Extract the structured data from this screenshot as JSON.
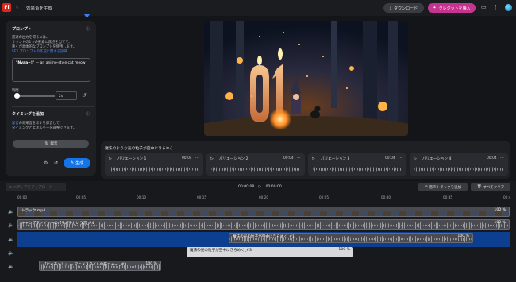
{
  "topbar": {
    "logo": "Fl",
    "title": "効果音を生成",
    "download_label": "ダウンロード",
    "buy_credits_label": "クレジットを購入"
  },
  "prompt_panel": {
    "title": "プロンプト",
    "description_line1": "最適の出力を得るには、",
    "description_line2": "サウンドの1つの要素に焦点を当てて、",
    "description_line3": "速くが具体的なプロンプトを使用します。",
    "link_text": "SFX プロンプトの作成に関する詳細",
    "prompt_quote": "\"Nyaa~!\"",
    "prompt_rest": " — an anime-style cat meow",
    "duration_label": "時間",
    "duration_value": "2s"
  },
  "timing_panel": {
    "title": "タイミングを追加",
    "description_link": "録音",
    "description_rest1": "の効果音を示すを録音して、",
    "description_line2": "タイミングとエネルギーを調整できます。",
    "record_label": "録音",
    "generate_label": "生成"
  },
  "variations": {
    "caption": "魔法のような光の粒子が空中にきらめく",
    "items": [
      {
        "name": "バリエーション 1",
        "duration": "00:04"
      },
      {
        "name": "バリエーション 2",
        "duration": "00:04"
      },
      {
        "name": "バリエーション 3",
        "duration": "00:04"
      },
      {
        "name": "バリエーション 4",
        "duration": "00:04"
      }
    ]
  },
  "timeline": {
    "upload_label": "メディアをアップロード",
    "current_time": "00:00:08",
    "total_time": "00:00:00",
    "add_track_label": "音声トラックを追加",
    "clear_all_label": "すべてクリア",
    "ruler_ticks": [
      "00:00",
      "00:05",
      "00:10",
      "00:15",
      "00:20",
      "00:25",
      "00:30",
      "00:35",
      "00:4"
    ],
    "clips": [
      {
        "label": "トラック.mp4",
        "percent": "100 %"
      },
      {
        "label": "キャンプファイヤーのパチパチという音_#4",
        "percent": "100 %"
      },
      {
        "label": "魔法の光の粒子が空中にきらめく_#1",
        "percent": "100 %"
      },
      {
        "label": "魔法の光の粒子が空中にきらめく_#3",
        "percent": "100 %"
      },
      {
        "label": "「にゃあ〜！」 — アニメスタイルの猫ニャー _#2",
        "percent": "100 %"
      }
    ]
  },
  "colors": {
    "accent_blue": "#1473e6",
    "buy_pink": "#c7348f",
    "logo_red": "#e1251b",
    "lane_blue": "#0d3f91"
  }
}
